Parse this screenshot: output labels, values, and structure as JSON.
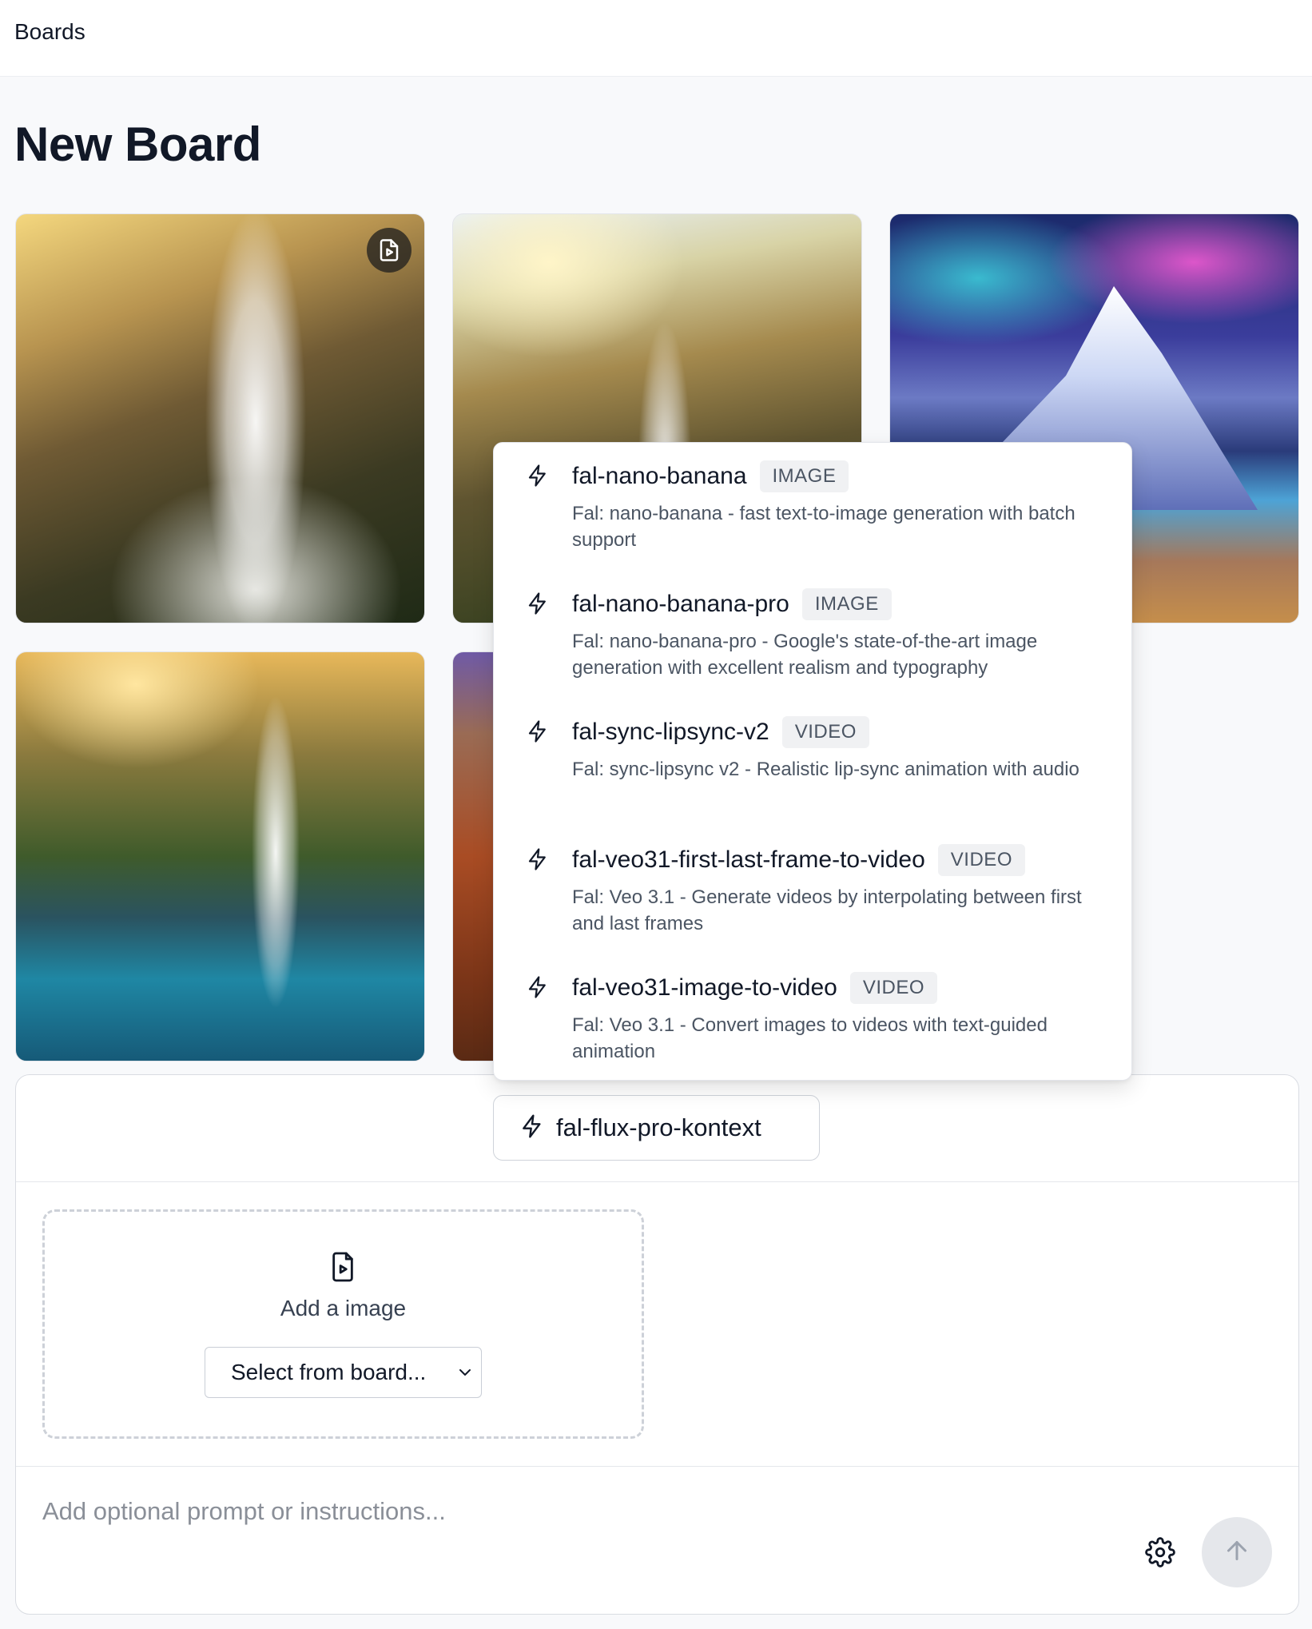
{
  "topbar": {
    "title": "Boards"
  },
  "page": {
    "title": "New Board"
  },
  "board_tiles": [
    {
      "alt": "Golden waterfall with rainbows",
      "icon": "file-video-icon"
    },
    {
      "alt": "Waterfall at sunrise with birds"
    },
    {
      "alt": "Aurora over snowy mountain and lake"
    },
    {
      "alt": "Tropical waterfall with rainbow and boat"
    },
    {
      "alt": "Red canyon (partially hidden)"
    }
  ],
  "dropdown": {
    "items": [
      {
        "name": "fal-nano-banana",
        "badge": "IMAGE",
        "description": "Fal: nano-banana - fast text-to-image generation with batch support"
      },
      {
        "name": "fal-nano-banana-pro",
        "badge": "IMAGE",
        "description": "Fal: nano-banana-pro - Google's state-of-the-art image generation with excellent realism and typography"
      },
      {
        "name": "fal-sync-lipsync-v2",
        "badge": "VIDEO",
        "description": "Fal: sync-lipsync v2 - Realistic lip-sync animation with audio"
      },
      {
        "name": "fal-veo31-first-last-frame-to-video",
        "badge": "VIDEO",
        "description": "Fal: Veo 3.1 - Generate videos by interpolating between first and last frames"
      },
      {
        "name": "fal-veo31-image-to-video",
        "badge": "VIDEO",
        "description": "Fal: Veo 3.1 - Convert images to videos with text-guided animation"
      }
    ]
  },
  "composer": {
    "selected_model": "fal-flux-pro-kontext",
    "dropzone_label": "Add a image",
    "select_board": "Select from board...",
    "prompt_placeholder": "Add optional prompt or instructions..."
  },
  "colors": {
    "text": "#111827",
    "muted": "#4b5563",
    "border": "#d9dce2",
    "send_bg": "#e5e7eb"
  }
}
